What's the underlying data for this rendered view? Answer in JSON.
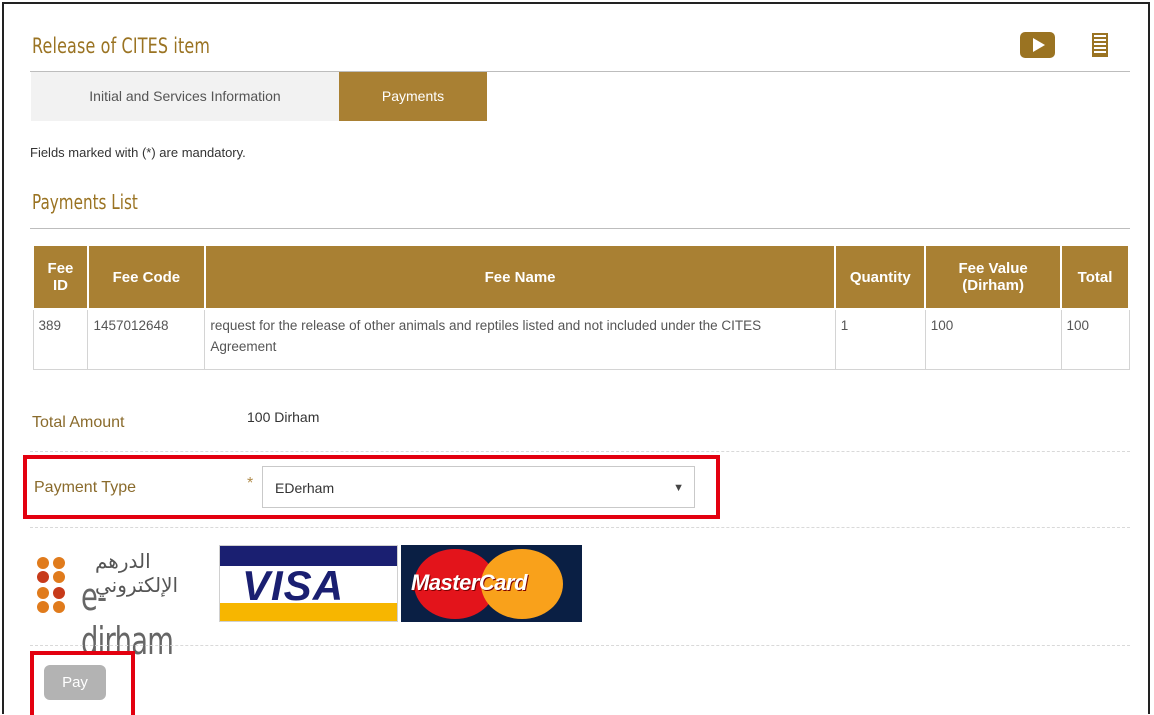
{
  "header": {
    "title": "Release of CITES item",
    "icons": [
      "video-play-icon",
      "document-icon"
    ]
  },
  "tabs": [
    {
      "label": "Initial and Services Information",
      "active": false
    },
    {
      "label": "Payments",
      "active": true
    }
  ],
  "mandatory_note": "Fields marked with (*) are mandatory.",
  "payments_list": {
    "title": "Payments List",
    "columns": {
      "fee_id": "Fee ID",
      "fee_code": "Fee Code",
      "fee_name": "Fee Name",
      "quantity": "Quantity",
      "fee_value": "Fee Value (Dirham)",
      "total": "Total"
    },
    "rows": [
      {
        "fee_id": "389",
        "fee_code": "1457012648",
        "fee_name": "request for the release of other animals and reptiles listed and not included under the CITES Agreement",
        "quantity": "1",
        "fee_value": "100",
        "total": "100"
      }
    ]
  },
  "total_amount": {
    "label": "Total Amount",
    "value": "100 Dirham"
  },
  "payment_type": {
    "label": "Payment Type",
    "required_marker": "*",
    "selected": "EDerham"
  },
  "payment_logos": {
    "edirham_arabic": "الدرهم الإلكتروني",
    "edirham": "e-dirham",
    "visa": "VISA",
    "mastercard": "MasterCard"
  },
  "pay_button": {
    "label": "Pay"
  },
  "colors": {
    "accent": "#a98033",
    "title": "#9a7322",
    "highlight": "#e3000f",
    "button_disabled": "#b3b3b3"
  }
}
